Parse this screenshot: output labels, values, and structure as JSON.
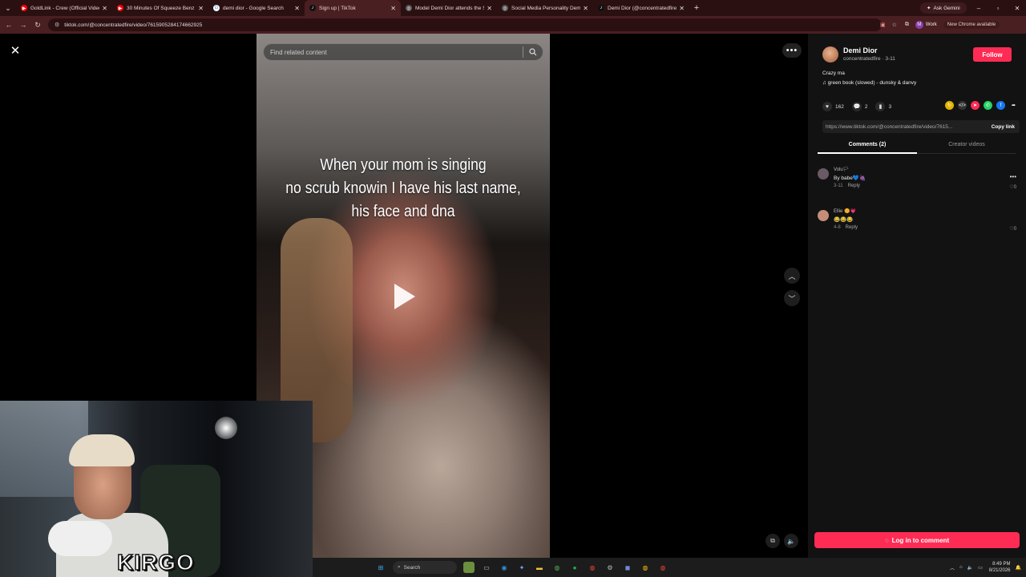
{
  "browser": {
    "tabs": [
      {
        "title": "GoldLink - Crew (Official Video...",
        "fav_color": "#ff0000",
        "fav_glyph": "▶",
        "active": false
      },
      {
        "title": "30 Minutes Of Squeeze Benz B...",
        "fav_color": "#ff0000",
        "fav_glyph": "▶",
        "active": false
      },
      {
        "title": "demi dior - Google Search",
        "fav_color": "#ffffff",
        "fav_glyph": "G",
        "active": false
      },
      {
        "title": "Sign up | TikTok",
        "fav_color": "#111111",
        "fav_glyph": "♪",
        "active": true
      },
      {
        "title": "Model Demi Dior attends the S...",
        "fav_color": "#555555",
        "fav_glyph": "◎",
        "active": false
      },
      {
        "title": "Social Media Personality Demi...",
        "fav_color": "#555555",
        "fav_glyph": "◎",
        "active": false
      },
      {
        "title": "Demi Dior (@concentratedfire)...",
        "fav_color": "#111111",
        "fav_glyph": "♪",
        "active": false
      }
    ],
    "ask_gemini": "Ask Gemini",
    "url": "tiktok.com/@concentratedfire/video/7615905284174662925",
    "profile_name": "Work",
    "profile_initial": "M",
    "new_chrome": "New Chrome available",
    "accent_color": "#4a1f22"
  },
  "video": {
    "search_placeholder": "Find related content",
    "caption_lines": [
      "When your mom is singing",
      "no scrub knowin I have his last name,",
      "his face and dna"
    ]
  },
  "panel": {
    "author_name": "Demi Dior",
    "author_sub": "concentratedfire · 3-11",
    "follow_label": "Follow",
    "description": "Crazy ma",
    "music": "green book (slowed) - dunsky & danvy",
    "likes": "162",
    "comments_count": "2",
    "saves": "3",
    "link_url": "https://www.tiktok.com/@concentratedfire/video/7615...",
    "copy_label": "Copy link",
    "tab_comments": "Comments (2)",
    "tab_creator": "Creator videos",
    "comments": [
      {
        "name": "Volu🏳",
        "text": "By babe💙🍇",
        "date": "3-11",
        "reply": "Reply",
        "likes": "0",
        "av_color": "#6a5a66"
      },
      {
        "name": "Ellie 🌼💗",
        "text": "😂😂😂",
        "date": "4-8",
        "reply": "Reply",
        "likes": "0",
        "av_color": "#c58d78"
      }
    ],
    "login_label": "Log in to comment",
    "brand_color": "#fe2c55"
  },
  "webcam": {
    "overlay_text": "KIRGO"
  },
  "taskbar": {
    "search_label": "Search",
    "time": "8:49 PM",
    "date": "8/21/2026"
  }
}
